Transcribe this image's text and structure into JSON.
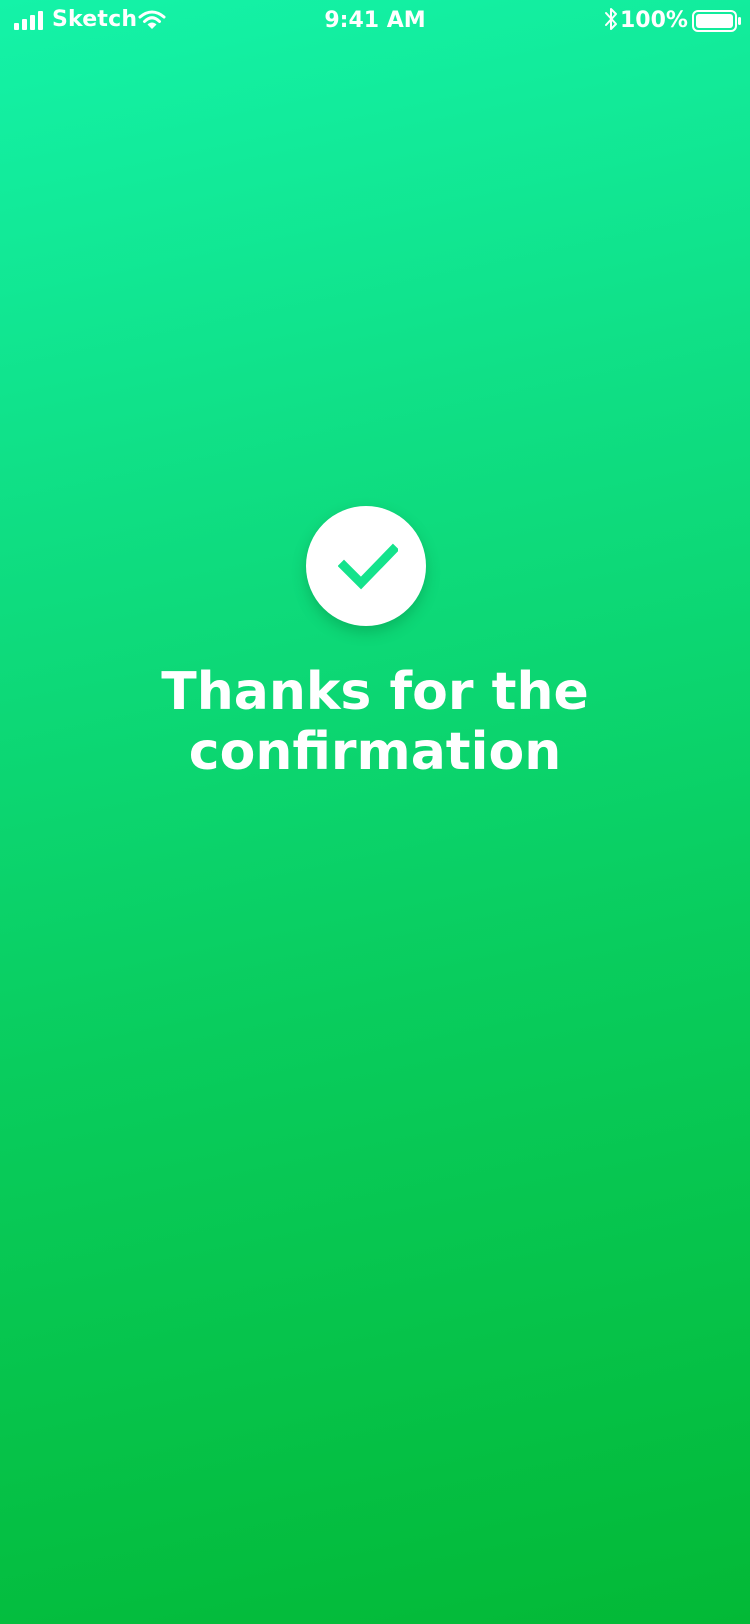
{
  "status_bar": {
    "carrier": "Sketch",
    "time": "9:41 AM",
    "battery_percent": "100%",
    "icons": [
      "signal-icon",
      "wifi-icon",
      "bluetooth-icon",
      "battery-icon"
    ]
  },
  "confirmation": {
    "icon": "check-icon",
    "message_line1": "Thanks for the",
    "message_line2": "confirmation"
  },
  "colors": {
    "gradient_top": "#14f3a8",
    "gradient_bottom": "#03b936",
    "check_mark": "#14e38c",
    "text": "#ffffff"
  }
}
